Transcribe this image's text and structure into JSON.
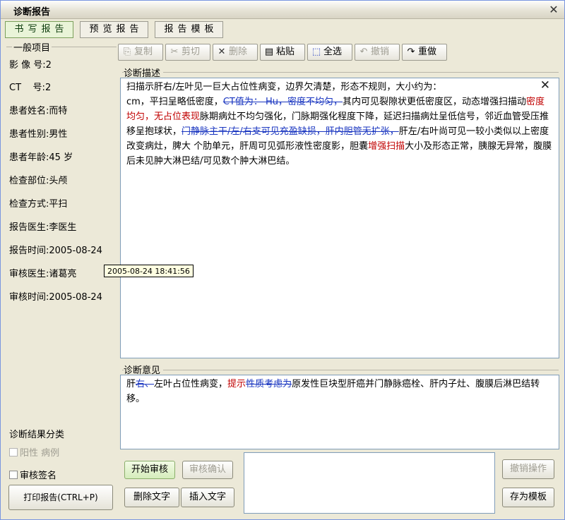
{
  "window": {
    "title": "诊断报告"
  },
  "tabs": [
    "书写报告",
    "预览报告",
    "报告模板"
  ],
  "sidebar": {
    "group_title": "一般项目",
    "fields": [
      {
        "label": "影 像 号:",
        "value": "2"
      },
      {
        "label": "CT    号:",
        "value": "2"
      },
      {
        "label": "患者姓名:",
        "value": "而特"
      },
      {
        "label": "患者性别:",
        "value": "男性"
      },
      {
        "label": "患者年龄:",
        "value": "45 岁"
      },
      {
        "label": "检查部位:",
        "value": "头颅"
      },
      {
        "label": "检查方式:",
        "value": "平扫"
      },
      {
        "label": "报告医生:",
        "value": "李医生"
      },
      {
        "label": "报告时间:",
        "value": "2005-08-24"
      },
      {
        "label": "审核医生:",
        "value": "诸葛亮"
      },
      {
        "label": "审核时间:",
        "value": "2005-08-24"
      }
    ],
    "tooltip": "2005-08-24 18:41:56",
    "result_class_label": "诊断结果分类",
    "positive_case_label": "阳性 病例",
    "review_sign_label": "审核签名",
    "print_button": "打印报告(CTRL+P)"
  },
  "toolbar": {
    "copy": "复制",
    "cut": "剪切",
    "delete": "删除",
    "paste": "粘贴",
    "select_all": "全选",
    "undo": "撤销",
    "redo": "重做"
  },
  "description": {
    "label": "诊断描述",
    "seg1": "扫描示肝右/左叶见一巨大占位性病变，边界欠清楚，形态不规则，大小约为：",
    "seg2": "cm，平扫呈略低密度，",
    "seg3_strike": "CT值为：    Hu，密度不均匀，",
    "seg4": "其内可见裂隙状更低密度区，动态增强扫描动",
    "seg5_red": "密度均匀，无占位表现",
    "seg6": "脉期病灶不均匀强化，门脉期强化程度下降，延迟扫描病灶呈低信号，邻近血管受压推移呈抱球状，",
    "seg7_strike": "门静脉主干/左/右支可见充盈缺损，肝内胆管无扩张，",
    "seg8": "肝左/右叶尚可见一较小类似以上密度改变病灶，脾大 个肋单元，肝周可见弧形液性密度影，胆囊",
    "seg9_red": "增强扫描",
    "seg10": "大小及形态正常，胰腺无异常，腹膜后未见肿大淋巴结/可见数个肿大淋巴结。"
  },
  "opinion": {
    "label": "诊断意见",
    "seg1": "肝",
    "seg2_strike": "右、",
    "seg3": "左叶占位性病变，",
    "seg4_red": "提示",
    "seg5_strike": "性质考虑为",
    "seg6": "原发性巨块型肝癌并门静脉癌栓、肝内子灶、腹膜后淋巴结转移。"
  },
  "actions": {
    "start_review": "开始审核",
    "confirm_review": "审核确认",
    "delete_text": "删除文字",
    "insert_text": "插入文字",
    "undo_operation": "撤销操作",
    "save_template": "存为模板"
  },
  "colors": {
    "red_text": "#c00000",
    "blue_text": "#1a36c0",
    "tooltip_bg": "#ffffe1"
  }
}
